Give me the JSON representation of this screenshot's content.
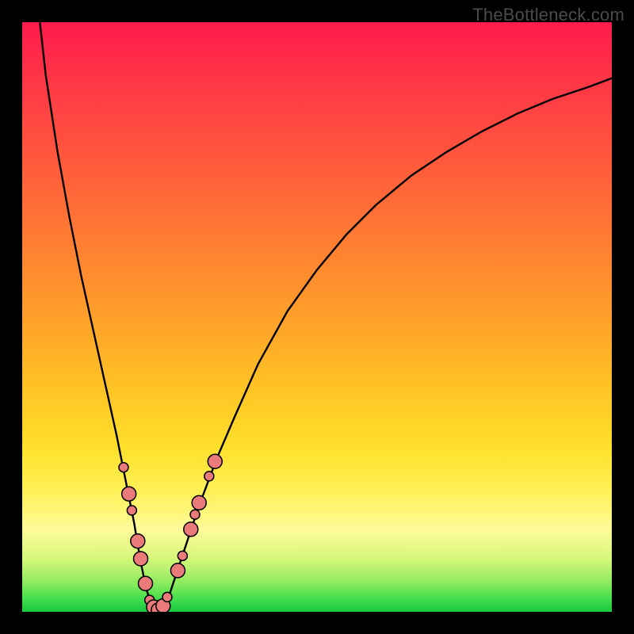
{
  "watermark": "TheBottleneck.com",
  "colors": {
    "frame": "#000000",
    "curve_stroke": "#000000",
    "marker_fill": "#eb7a7a",
    "marker_stroke": "#000000",
    "gradient_stops": [
      "#ff1b4d",
      "#ff5a3c",
      "#ff9a2b",
      "#ffe02a",
      "#fffb9a",
      "#3fdc4d",
      "#18c93e"
    ]
  },
  "chart_data": {
    "type": "line",
    "title": "",
    "xlabel": "",
    "ylabel": "",
    "xlim": [
      0,
      100
    ],
    "ylim": [
      0,
      100
    ],
    "grid": false,
    "legend": false,
    "description": "V-shaped bottleneck curve on red→green gradient; minimum marks the optimal match point.",
    "x": [
      3,
      4,
      6,
      8,
      10,
      12,
      14,
      16,
      17,
      18,
      19,
      20,
      21,
      22,
      23,
      24,
      25,
      26,
      28,
      30,
      33,
      36,
      40,
      45,
      50,
      55,
      60,
      66,
      72,
      78,
      84,
      90,
      96,
      100
    ],
    "y": [
      100,
      91,
      78,
      67,
      57,
      48,
      39,
      30,
      25,
      20,
      15,
      9,
      4,
      1,
      0,
      1,
      3,
      6,
      12,
      18,
      26,
      33,
      42,
      51,
      58,
      64,
      69,
      74,
      78,
      81.5,
      84.5,
      87,
      89,
      90.5
    ],
    "minimum_x": 23,
    "markers": [
      {
        "x": 17.2,
        "y": 24.5,
        "r": "s"
      },
      {
        "x": 18.1,
        "y": 20.0,
        "r": "m"
      },
      {
        "x": 18.6,
        "y": 17.2,
        "r": "s"
      },
      {
        "x": 19.6,
        "y": 12.0,
        "r": "m"
      },
      {
        "x": 20.1,
        "y": 9.0,
        "r": "m"
      },
      {
        "x": 20.9,
        "y": 4.8,
        "r": "m"
      },
      {
        "x": 21.6,
        "y": 2.0,
        "r": "s"
      },
      {
        "x": 22.3,
        "y": 0.8,
        "r": "m"
      },
      {
        "x": 23.1,
        "y": 0.3,
        "r": "m"
      },
      {
        "x": 23.9,
        "y": 1.0,
        "r": "m"
      },
      {
        "x": 24.6,
        "y": 2.5,
        "r": "s"
      },
      {
        "x": 26.4,
        "y": 7.0,
        "r": "m"
      },
      {
        "x": 27.2,
        "y": 9.5,
        "r": "s"
      },
      {
        "x": 28.6,
        "y": 14.0,
        "r": "m"
      },
      {
        "x": 29.3,
        "y": 16.5,
        "r": "s"
      },
      {
        "x": 30.0,
        "y": 18.5,
        "r": "m"
      },
      {
        "x": 31.7,
        "y": 23.0,
        "r": "s"
      },
      {
        "x": 32.7,
        "y": 25.5,
        "r": "m"
      }
    ],
    "marker_radii_px": {
      "s": 6,
      "m": 9
    }
  }
}
